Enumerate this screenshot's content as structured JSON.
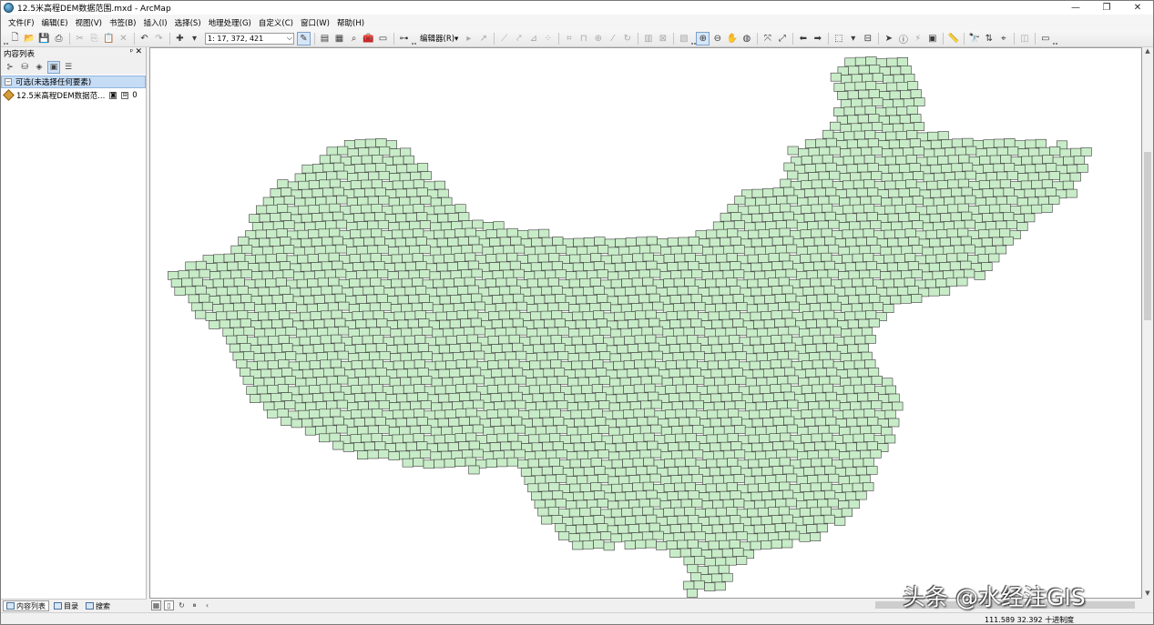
{
  "window": {
    "title": "12.5米高程DEM数据范围.mxd - ArcMap",
    "minimize": "—",
    "maximize": "❐",
    "close": "✕"
  },
  "menu": [
    "文件(F)",
    "编辑(E)",
    "视图(V)",
    "书签(B)",
    "插入(I)",
    "选择(S)",
    "地理处理(G)",
    "自定义(C)",
    "窗口(W)",
    "帮助(H)"
  ],
  "toolbar": {
    "scale": "1: 17, 372, 421",
    "editor_label": "编辑器(R)▾"
  },
  "toc": {
    "title": "内容列表",
    "pin": "ᵖ",
    "close": "✕",
    "group_label": "可选(未选择任何要素)",
    "layer_label": "12.5米高程DEM数据范...",
    "layer_count": "0",
    "tabs": [
      "内容列表",
      "目录",
      "搜索"
    ]
  },
  "map": {
    "tile_fill": "#c8ecc8",
    "tile_stroke": "#3c3c3c"
  },
  "watermark": "头条 @水经注GIS",
  "status": {
    "coordinates": "111.589  32.392 十进制度"
  }
}
